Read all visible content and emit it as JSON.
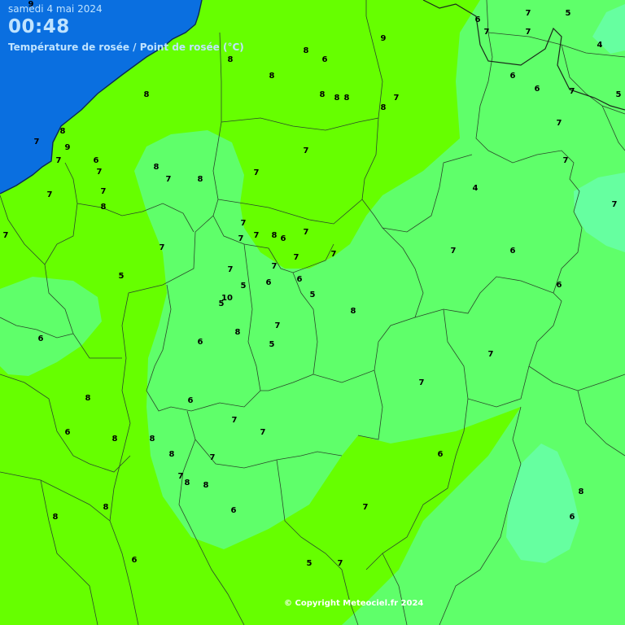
{
  "header": {
    "date": "samedi 4 mai 2024",
    "time": "00:48",
    "title": "Température de rosée / Point de rosée (°C)"
  },
  "copyright": "© Copyright Meteociel.fr 2024",
  "colors": {
    "sea": "#0a6fe0",
    "band_7_9": "#66ff00",
    "band_5_7": "#5fff6a",
    "band_3_5": "#66ffa0",
    "borders": "#2a4a2a",
    "coast": "#0a2a55"
  },
  "values": [
    "9",
    "8",
    "8",
    "6",
    "9",
    "8",
    "8",
    "8",
    "8",
    "8",
    "7",
    "8",
    "8",
    "9",
    "7",
    "7",
    "6",
    "7",
    "7",
    "8",
    "7",
    "8",
    "7",
    "7",
    "7",
    "8",
    "7",
    "7",
    "7",
    "8",
    "6",
    "7",
    "7",
    "7",
    "7",
    "7",
    "7",
    "6",
    "5",
    "7",
    "5",
    "6",
    "5",
    "10",
    "5",
    "8",
    "8",
    "7",
    "6",
    "6",
    "5",
    "8",
    "6",
    "6",
    "8",
    "8",
    "7",
    "7",
    "8",
    "7",
    "7",
    "8",
    "8",
    "8",
    "8",
    "6",
    "6",
    "5",
    "7",
    "7",
    "6",
    "7",
    "7",
    "6",
    "7",
    "6",
    "4",
    "7",
    "7",
    "6",
    "6",
    "7",
    "6",
    "7",
    "5",
    "4",
    "7",
    "5",
    "7",
    "7",
    "8",
    "6"
  ]
}
